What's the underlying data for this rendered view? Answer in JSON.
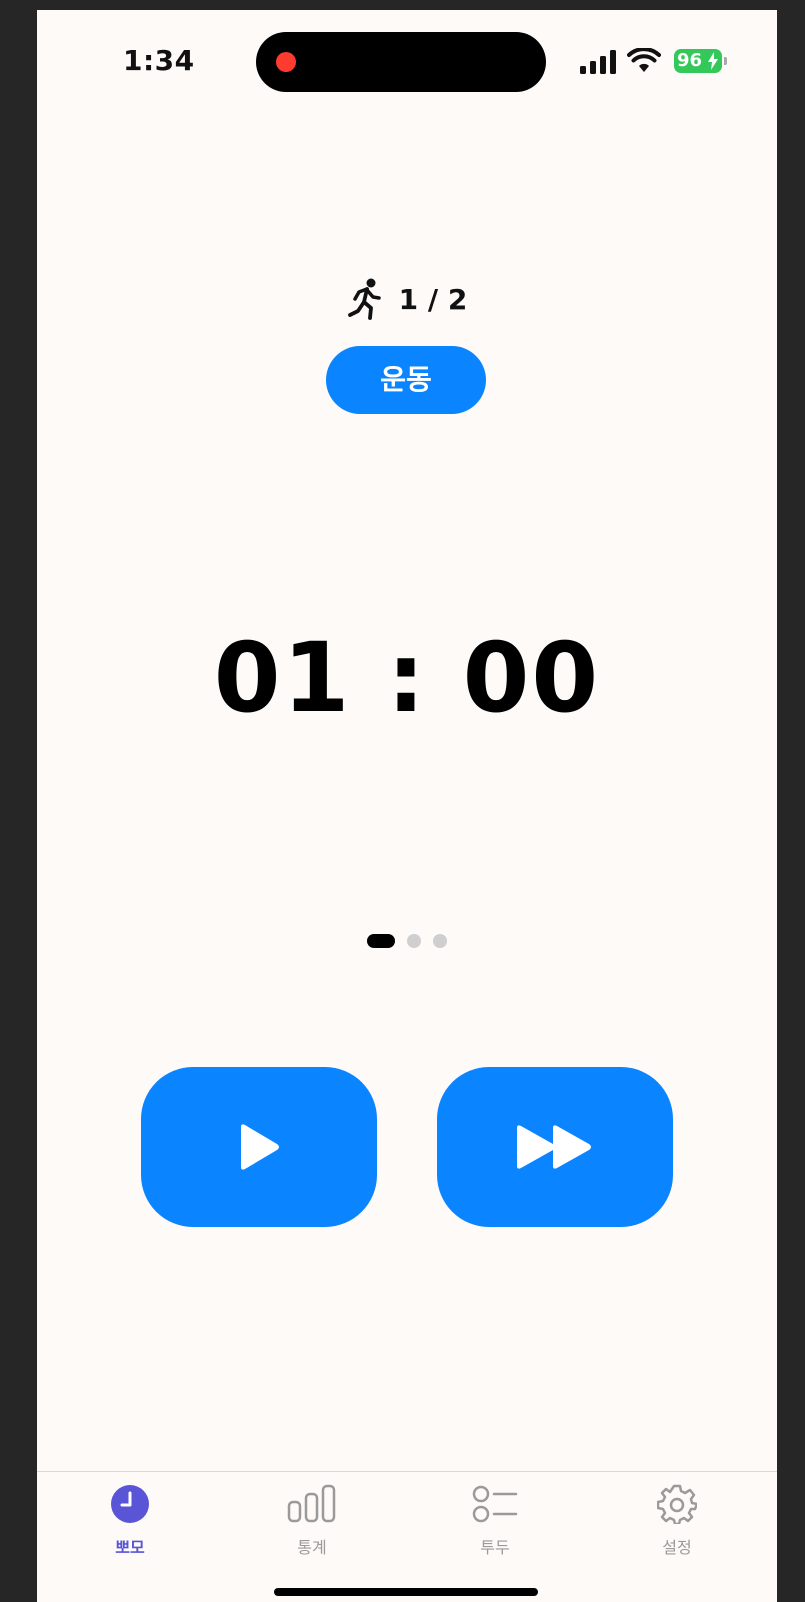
{
  "status_bar": {
    "time": "1:34",
    "battery": "96"
  },
  "session": {
    "icon": "running-person-icon",
    "count": "1 / 2",
    "mode_label": "운동"
  },
  "timer": {
    "display": "01 : 00"
  },
  "page_indicator": {
    "total": 3,
    "current": 1
  },
  "controls": {
    "play_icon": "play-icon",
    "skip_icon": "fast-forward-icon"
  },
  "tab_bar": {
    "tabs": [
      {
        "label": "뽀모",
        "icon": "clock-icon",
        "active": true
      },
      {
        "label": "통계",
        "icon": "bar-chart-icon",
        "active": false
      },
      {
        "label": "투두",
        "icon": "list-icon",
        "active": false
      },
      {
        "label": "설정",
        "icon": "gear-icon",
        "active": false
      }
    ]
  },
  "colors": {
    "accent": "#0a84ff",
    "tab_active": "#5a55d6",
    "battery": "#34c759",
    "recording": "#ff3b30"
  }
}
